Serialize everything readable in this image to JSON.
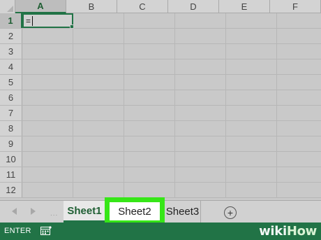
{
  "columns": [
    "A",
    "B",
    "C",
    "D",
    "E",
    "F"
  ],
  "rows": [
    "1",
    "2",
    "3",
    "4",
    "5",
    "6",
    "7",
    "8",
    "9",
    "10",
    "11",
    "12"
  ],
  "active_cell": {
    "column": "A",
    "row": "1",
    "value": "="
  },
  "sheet_tabs": {
    "more_indicator": "...",
    "tabs": [
      "Sheet1",
      "Sheet2",
      "Sheet3"
    ],
    "active": "Sheet1",
    "highlighted": "Sheet2",
    "add_label": "+"
  },
  "status_bar": {
    "mode": "ENTER"
  },
  "watermark": {
    "part_a": "wiki",
    "part_b": "How"
  },
  "colors": {
    "accent": "#217346",
    "highlight": "#36e617",
    "grid_bg": "#c9c9c9"
  },
  "icons": {
    "nav_left": "triangle-left-icon",
    "nav_right": "triangle-right-icon",
    "add_sheet": "plus-circle-icon",
    "macro": "macro-record-icon"
  }
}
